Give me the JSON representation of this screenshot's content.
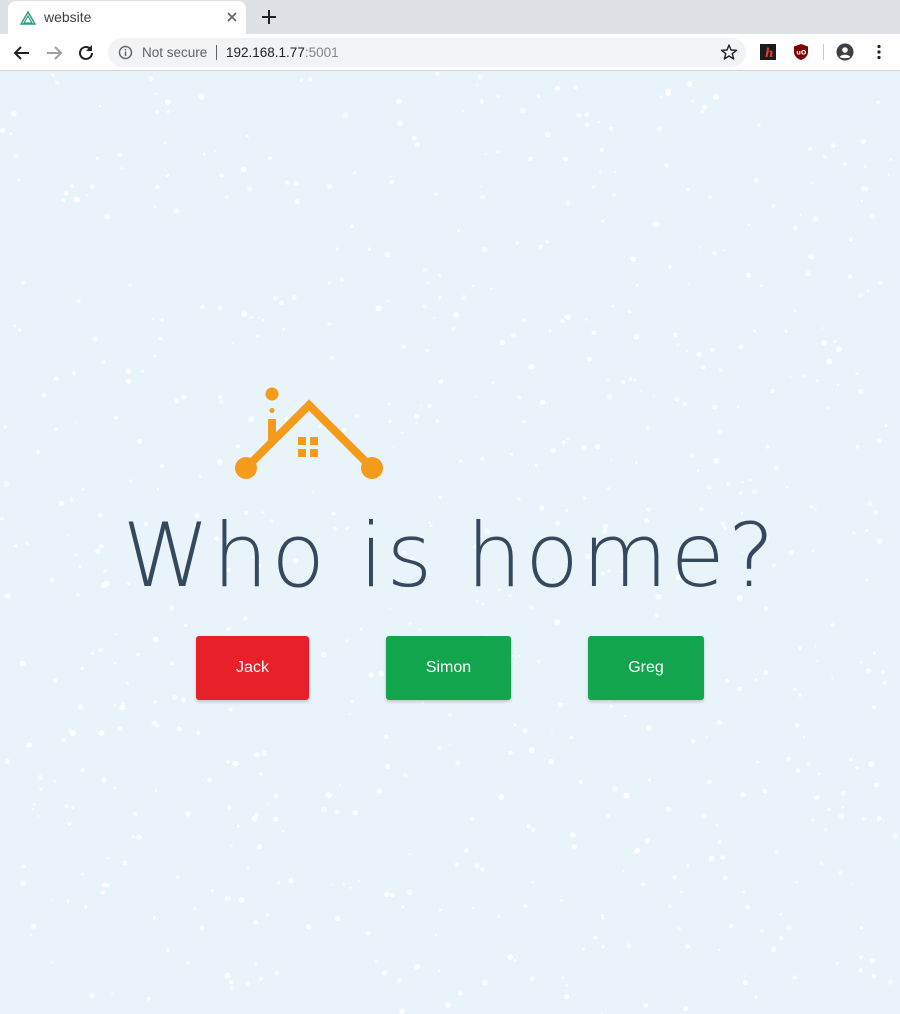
{
  "browser": {
    "tab": {
      "title": "website"
    },
    "address_bar": {
      "security_text": "Not secure",
      "host": "192.168.1.77",
      "port": ":5001"
    },
    "icons": [
      "vue-favicon-icon",
      "close-icon",
      "plus-icon",
      "back-arrow-icon",
      "forward-arrow-icon",
      "reload-icon",
      "info-icon",
      "star-icon",
      "extension-h-icon",
      "ublock-origin-icon",
      "account-icon",
      "more-vert-icon"
    ]
  },
  "page": {
    "heading": "Who is home?",
    "people": [
      {
        "name": "Jack",
        "status": "away",
        "color": "#e8202a"
      },
      {
        "name": "Simon",
        "status": "home",
        "color": "#12a54d"
      },
      {
        "name": "Greg",
        "status": "home",
        "color": "#12a54d"
      }
    ],
    "colors": {
      "background": "#e8f3fa",
      "heading": "#34495e",
      "logo": "#f59b1c"
    }
  }
}
